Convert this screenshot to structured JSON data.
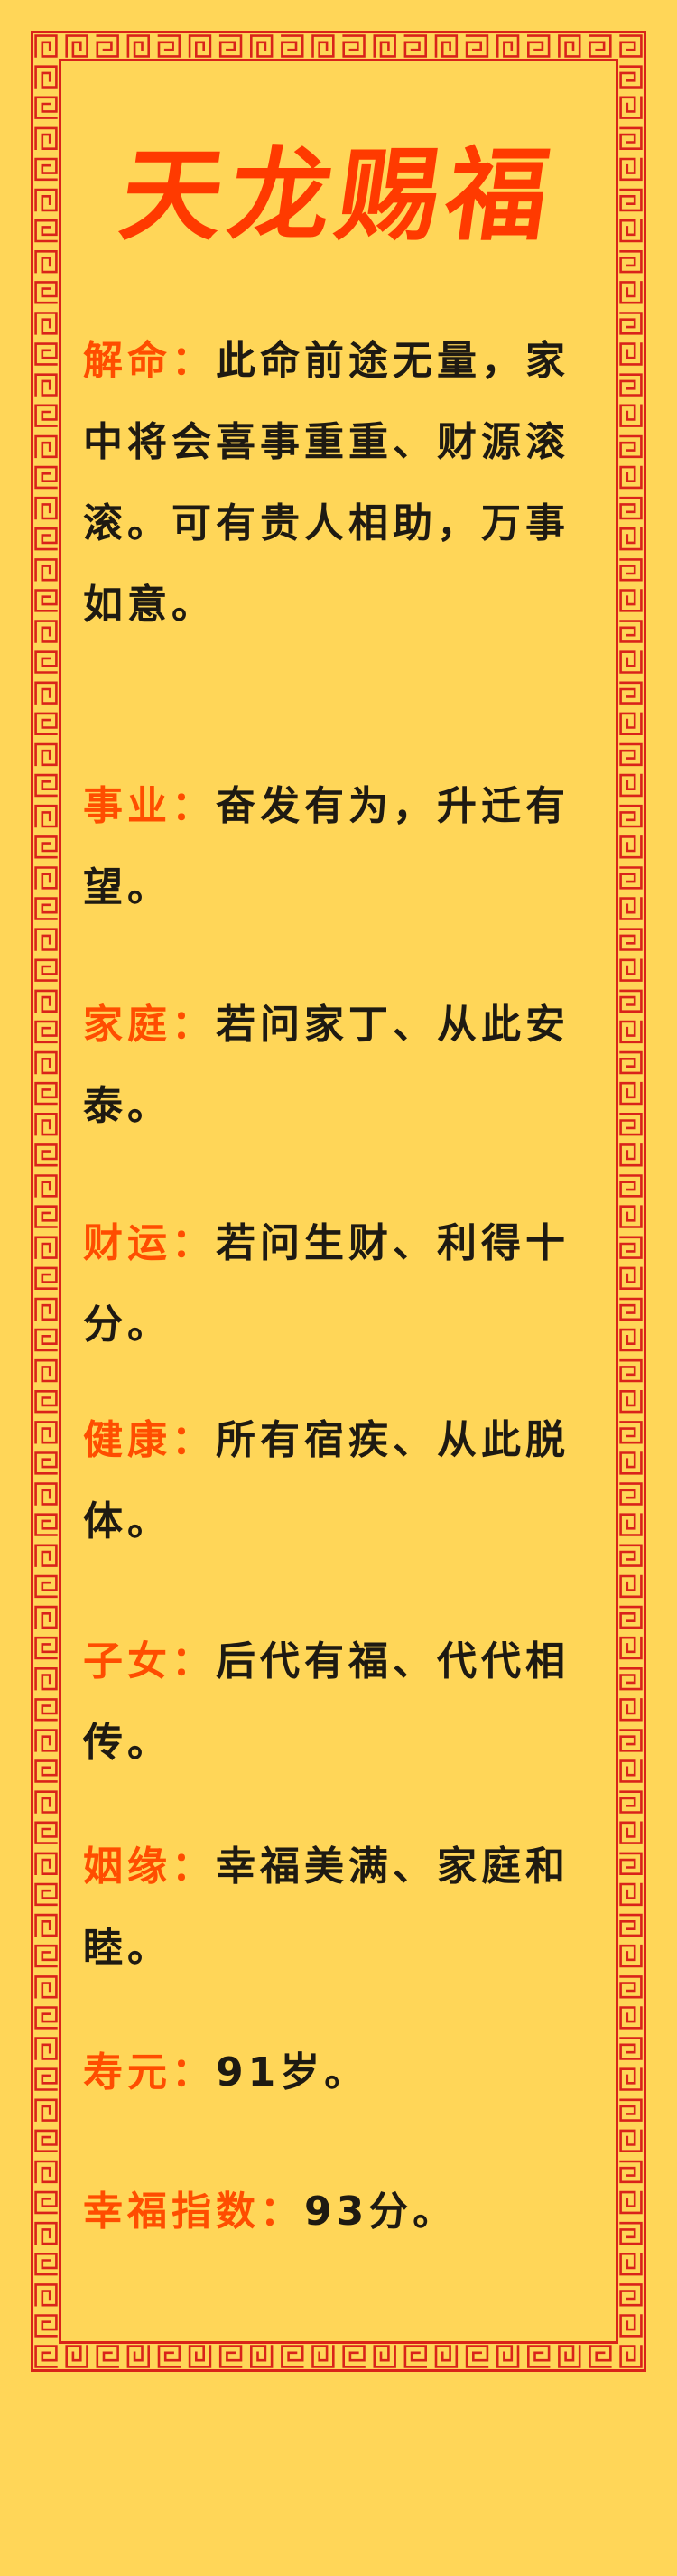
{
  "title": "天龙赐福",
  "colors": {
    "background": "#ffd658",
    "border": "#d9231a",
    "title": "#ff3a00",
    "label": "#ff4d00",
    "text": "#1e1a12"
  },
  "sections": [
    {
      "label": "解命：",
      "text": "此命前途无量，家中将会喜事重重、财源滚滚。可有贵人相助，万事如意。"
    },
    {
      "label": "事业：",
      "text": "奋发有为，升迁有望。"
    },
    {
      "label": "家庭：",
      "text": "若问家丁、从此安泰。"
    },
    {
      "label": "财运：",
      "text": "若问生财、利得十分。"
    },
    {
      "label": "健康：",
      "text": "所有宿疾、从此脱体。"
    },
    {
      "label": "子女：",
      "text": "后代有福、代代相传。"
    },
    {
      "label": "姻缘：",
      "text": "幸福美满、家庭和睦。"
    },
    {
      "label": "寿元：",
      "text": "91岁。"
    },
    {
      "label": "幸福指数：",
      "text": "93分。"
    }
  ]
}
